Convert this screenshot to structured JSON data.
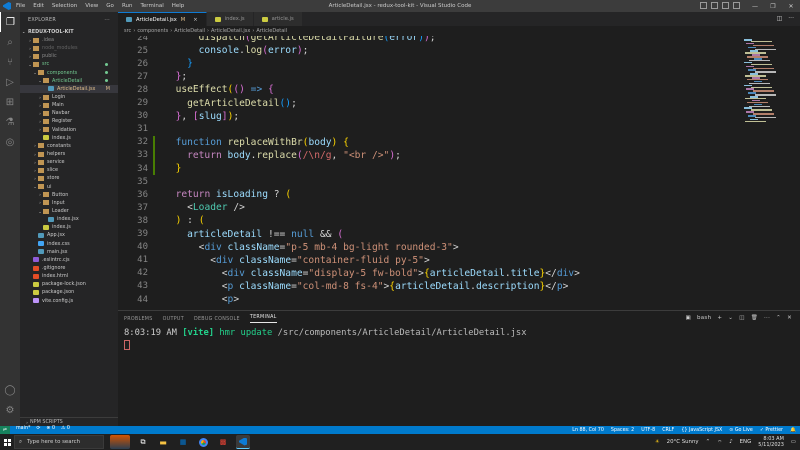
{
  "titlebar": {
    "menu": [
      "File",
      "Edit",
      "Selection",
      "View",
      "Go",
      "Run",
      "Terminal",
      "Help"
    ],
    "window_title": "ArticleDetail.jsx - redux-tool-kit - Visual Studio Code",
    "controls": [
      "—",
      "❐",
      "✕"
    ]
  },
  "activity_icons": [
    "files-icon",
    "search-icon",
    "source-control-icon",
    "run-debug-icon",
    "extensions-icon",
    "test-icon",
    "remote-icon",
    "account-icon",
    "settings-gear-icon"
  ],
  "sidebar": {
    "header": "EXPLORER",
    "project": "REDUX-TOOL-KIT",
    "tree": [
      {
        "label": ".idea",
        "depth": 1,
        "chev": "›",
        "color": "#8a8a8a"
      },
      {
        "label": "node_modules",
        "depth": 1,
        "chev": "›",
        "color": "#8a8a8a",
        "dim": true
      },
      {
        "label": "public",
        "depth": 1,
        "chev": "›",
        "color": "#8a8a8a"
      },
      {
        "label": "src",
        "depth": 1,
        "chev": "⌄",
        "color": "#73c991",
        "dot": true
      },
      {
        "label": "components",
        "depth": 2,
        "chev": "⌄",
        "color": "#73c991",
        "dot": true
      },
      {
        "label": "ArticleDetail",
        "depth": 3,
        "chev": "⌄",
        "color": "#73c991",
        "dot": true
      },
      {
        "label": "ArticleDetail.jsx",
        "depth": 4,
        "chev": "",
        "color": "#e2c08d",
        "icon": "#519aba",
        "sel": true,
        "mark": "M"
      },
      {
        "label": "Login",
        "depth": 3,
        "chev": "›",
        "color": "#cccccc"
      },
      {
        "label": "Main",
        "depth": 3,
        "chev": "›",
        "color": "#cccccc"
      },
      {
        "label": "Navbar",
        "depth": 3,
        "chev": "›",
        "color": "#cccccc"
      },
      {
        "label": "Register",
        "depth": 3,
        "chev": "›",
        "color": "#cccccc"
      },
      {
        "label": "Validation",
        "depth": 3,
        "chev": "›",
        "color": "#cccccc"
      },
      {
        "label": "index.js",
        "depth": 3,
        "chev": "",
        "color": "#cccccc",
        "icon": "#cbcb41"
      },
      {
        "label": "constants",
        "depth": 2,
        "chev": "›",
        "color": "#cccccc"
      },
      {
        "label": "helpers",
        "depth": 2,
        "chev": "›",
        "color": "#cccccc"
      },
      {
        "label": "service",
        "depth": 2,
        "chev": "›",
        "color": "#cccccc"
      },
      {
        "label": "slice",
        "depth": 2,
        "chev": "›",
        "color": "#cccccc"
      },
      {
        "label": "store",
        "depth": 2,
        "chev": "›",
        "color": "#cccccc"
      },
      {
        "label": "ui",
        "depth": 2,
        "chev": "⌄",
        "color": "#cccccc"
      },
      {
        "label": "Button",
        "depth": 3,
        "chev": "›",
        "color": "#cccccc"
      },
      {
        "label": "Input",
        "depth": 3,
        "chev": "›",
        "color": "#cccccc"
      },
      {
        "label": "Loader",
        "depth": 3,
        "chev": "⌄",
        "color": "#cccccc"
      },
      {
        "label": "index.jsx",
        "depth": 4,
        "chev": "",
        "color": "#cccccc",
        "icon": "#519aba"
      },
      {
        "label": "index.js",
        "depth": 3,
        "chev": "",
        "color": "#cccccc",
        "icon": "#cbcb41"
      },
      {
        "label": "App.jsx",
        "depth": 2,
        "chev": "",
        "color": "#cccccc",
        "icon": "#519aba"
      },
      {
        "label": "index.css",
        "depth": 2,
        "chev": "",
        "color": "#cccccc",
        "icon": "#42a5f5"
      },
      {
        "label": "main.jsx",
        "depth": 2,
        "chev": "",
        "color": "#cccccc",
        "icon": "#519aba"
      },
      {
        "label": ".eslintrc.cjs",
        "depth": 1,
        "chev": "",
        "color": "#cccccc",
        "icon": "#8f5cd8"
      },
      {
        "label": ".gitignore",
        "depth": 1,
        "chev": "",
        "color": "#cccccc",
        "icon": "#e44d26"
      },
      {
        "label": "index.html",
        "depth": 1,
        "chev": "",
        "color": "#cccccc",
        "icon": "#e44d26"
      },
      {
        "label": "package-lock.json",
        "depth": 1,
        "chev": "",
        "color": "#cccccc",
        "icon": "#cbcb41"
      },
      {
        "label": "package.json",
        "depth": 1,
        "chev": "",
        "color": "#cccccc",
        "icon": "#cbcb41"
      },
      {
        "label": "vite.config.js",
        "depth": 1,
        "chev": "",
        "color": "#cccccc",
        "icon": "#bd93f9"
      }
    ],
    "outline": "OUTLINE",
    "timeline": "TIMELINE",
    "npm": "NPM SCRIPTS"
  },
  "tabs": [
    {
      "label": "ArticleDetail.jsx",
      "active": true,
      "mark": "M",
      "icon": "#519aba"
    },
    {
      "label": "index.js",
      "active": false,
      "icon": "#cbcb41"
    },
    {
      "label": "article.js",
      "active": false,
      "icon": "#cbcb41"
    }
  ],
  "breadcrumb": [
    "src",
    "components",
    "ArticleDetail",
    "ArticleDetail.jsx",
    "ArticleDetail"
  ],
  "code_lines": [
    {
      "n": "24",
      "html": "      <span class='fn'>dispatch</span><span class='br2'>(</span><span class='fn'>getArticleDetailFailure</span><span class='br3'>(</span><span class='var'>error</span><span class='br3'>)</span><span class='br2'>)</span><span class='pun'>;</span>"
    },
    {
      "n": "25",
      "html": "      <span class='var'>console</span><span class='pun'>.</span><span class='fn'>log</span><span class='br2'>(</span><span class='var'>error</span><span class='br2'>)</span><span class='pun'>;</span>"
    },
    {
      "n": "26",
      "html": "    <span class='br3'>}</span>"
    },
    {
      "n": "27",
      "html": "  <span class='br2'>}</span><span class='pun'>;</span>"
    },
    {
      "n": "28",
      "html": "  <span class='fn'>useEffect</span><span class='br1'>(</span><span class='br2'>()</span> <span class='tag'>=&gt;</span> <span class='br2'>{</span>"
    },
    {
      "n": "29",
      "html": "    <span class='fn'>getArticleDetail</span><span class='br3'>()</span><span class='pun'>;</span>"
    },
    {
      "n": "30",
      "html": "  <span class='br2'>}</span><span class='pun'>, </span><span class='br2'>[</span><span class='var'>slug</span><span class='br2'>]</span><span class='br1'>)</span><span class='pun'>;</span>"
    },
    {
      "n": "31",
      "html": ""
    },
    {
      "n": "32",
      "html": "  <span class='tag'>function</span> <span class='fn'>replaceWithBr</span><span class='br1'>(</span><span class='var'>body</span><span class='br1'>)</span> <span class='br1'>{</span>",
      "gut": true
    },
    {
      "n": "33",
      "html": "    <span class='kw'>return</span> <span class='var'>body</span><span class='pun'>.</span><span class='fn'>replace</span><span class='br2'>(</span><span class='rgx'>/\\n/g</span><span class='pun'>, </span><span class='str'>\"&lt;br /&gt;\"</span><span class='br2'>)</span><span class='pun'>;</span>",
      "gut": true
    },
    {
      "n": "34",
      "html": "  <span class='br1'>}</span>",
      "gut": true
    },
    {
      "n": "35",
      "html": ""
    },
    {
      "n": "36",
      "html": "  <span class='kw'>return</span> <span class='var'>isLoading</span> <span class='pun'>?</span> <span class='br1'>(</span>"
    },
    {
      "n": "37",
      "html": "    <span class='pun'>&lt;</span><span class='comp'>Loader</span> <span class='pun'>/&gt;</span>"
    },
    {
      "n": "38",
      "html": "  <span class='br1'>)</span> <span class='pun'>:</span> <span class='br1'>(</span>"
    },
    {
      "n": "39",
      "html": "    <span class='var'>articleDetail</span> <span class='pun'>!==</span> <span class='tag'>null</span> <span class='pun'>&amp;&amp;</span> <span class='br2'>(</span>"
    },
    {
      "n": "40",
      "html": "      <span class='pun'>&lt;</span><span class='tag'>div</span> <span class='attr'>className</span><span class='pun'>=</span><span class='str'>\"p-5 mb-4 bg-light rounded-3\"</span><span class='pun'>&gt;</span>"
    },
    {
      "n": "41",
      "html": "        <span class='pun'>&lt;</span><span class='tag'>div</span> <span class='attr'>className</span><span class='pun'>=</span><span class='str'>\"container-fluid py-5\"</span><span class='pun'>&gt;</span>"
    },
    {
      "n": "42",
      "html": "          <span class='pun'>&lt;</span><span class='tag'>div</span> <span class='attr'>className</span><span class='pun'>=</span><span class='str'>\"display-5 fw-bold\"</span><span class='pun'>&gt;</span><span class='br1'>{</span><span class='var'>articleDetail</span><span class='pun'>.</span><span class='var'>title</span><span class='br1'>}</span><span class='pun'>&lt;/</span><span class='tag'>div</span><span class='pun'>&gt;</span>"
    },
    {
      "n": "43",
      "html": "          <span class='pun'>&lt;</span><span class='tag'>p</span> <span class='attr'>className</span><span class='pun'>=</span><span class='str'>\"col-md-8 fs-4\"</span><span class='pun'>&gt;</span><span class='br1'>{</span><span class='var'>articleDetail</span><span class='pun'>.</span><span class='var'>description</span><span class='br1'>}</span><span class='pun'>&lt;/</span><span class='tag'>p</span><span class='pun'>&gt;</span>"
    },
    {
      "n": "44",
      "html": "          <span class='pun'>&lt;</span><span class='tag'>p</span><span class='pun'>&gt;</span>"
    }
  ],
  "panel": {
    "tabs": [
      "PROBLEMS",
      "OUTPUT",
      "DEBUG CONSOLE",
      "TERMINAL"
    ],
    "active_tab": "TERMINAL",
    "shell": "bash",
    "terminal_time": "8:03:19 AM",
    "terminal_tag": "[vite]",
    "terminal_msg": "hmr update",
    "terminal_path": "/src/components/ArticleDetail/ArticleDetail.jsx"
  },
  "status": {
    "branch": "main*",
    "sync": "⟳",
    "errors": "⊗ 0",
    "warnings": "⚠ 0",
    "position": "Ln 88, Col 70",
    "spaces": "Spaces: 2",
    "encoding": "UTF-8",
    "eol": "CRLF",
    "language": "{} JavaScript JSX",
    "golive": "⊙ Go Live",
    "prettier": "✓ Prettier"
  },
  "taskbar": {
    "search_placeholder": "Type here to search",
    "weather": "20°C  Sunny",
    "lang": "ENG",
    "time": "8:03 AM",
    "date": "5/11/2023"
  },
  "colors": {
    "accent": "#007acc",
    "titlebar": "#3c3c3c",
    "editor_bg": "#1e1e1e",
    "sidebar_bg": "#252526"
  }
}
